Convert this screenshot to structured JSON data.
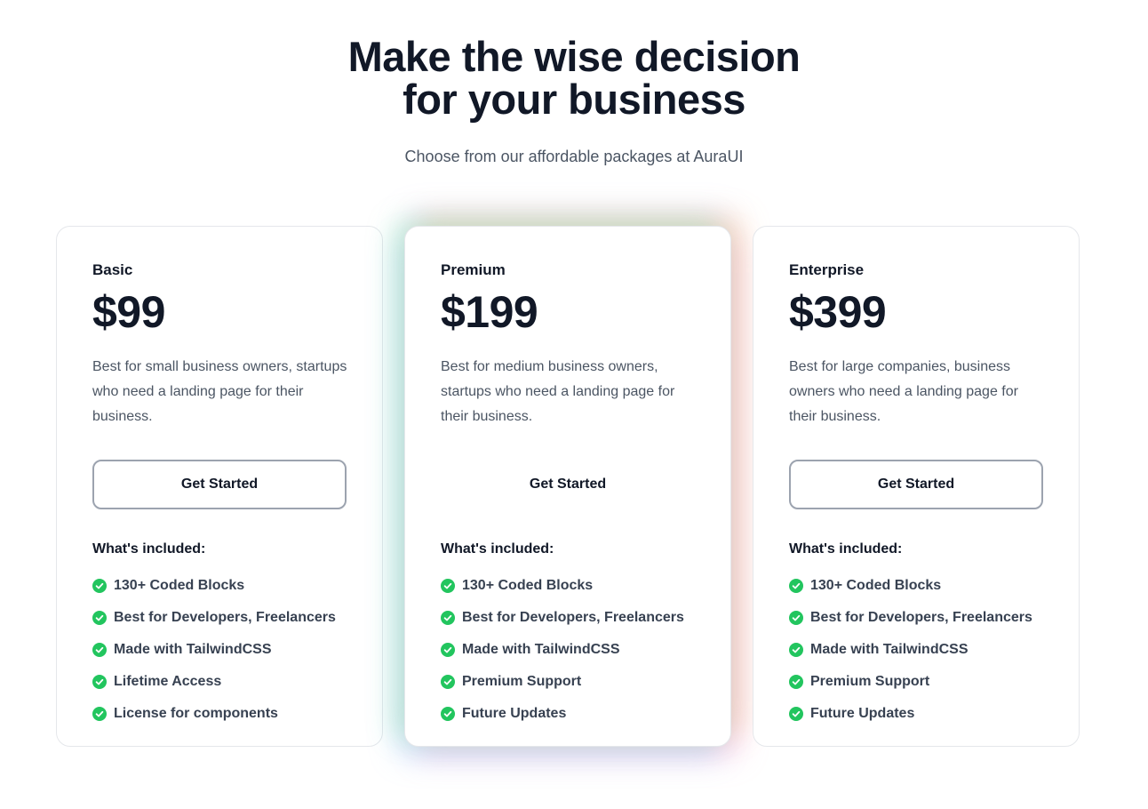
{
  "hero": {
    "title_line1": "Make the wise decision",
    "title_line2": "for your business",
    "subtitle": "Choose from our affordable packages at AuraUI"
  },
  "colors": {
    "text_primary": "#111827",
    "text_secondary": "#4b5563",
    "check_green": "#22c55e",
    "button_border": "#9ca3af"
  },
  "plans": [
    {
      "name": "Basic",
      "price": "$99",
      "description": "Best for small business owners, startups who need a landing page for their business.",
      "cta": "Get Started",
      "included_title": "What's included:",
      "features": [
        "130+ Coded Blocks",
        "Best for Developers, Freelancers",
        "Made with TailwindCSS",
        "Lifetime Access",
        "License for components"
      ]
    },
    {
      "name": "Premium",
      "price": "$199",
      "description": "Best for medium business owners, startups who need a landing page for their business.",
      "cta": "Get Started",
      "included_title": "What's included:",
      "features": [
        "130+ Coded Blocks",
        "Best for Developers, Freelancers",
        "Made with TailwindCSS",
        "Premium Support",
        "Future Updates"
      ]
    },
    {
      "name": "Enterprise",
      "price": "$399",
      "description": "Best for large companies, business owners who need a landing page for their business.",
      "cta": "Get Started",
      "included_title": "What's included:",
      "features": [
        "130+ Coded Blocks",
        "Best for Developers, Freelancers",
        "Made with TailwindCSS",
        "Premium Support",
        "Future Updates"
      ]
    }
  ]
}
